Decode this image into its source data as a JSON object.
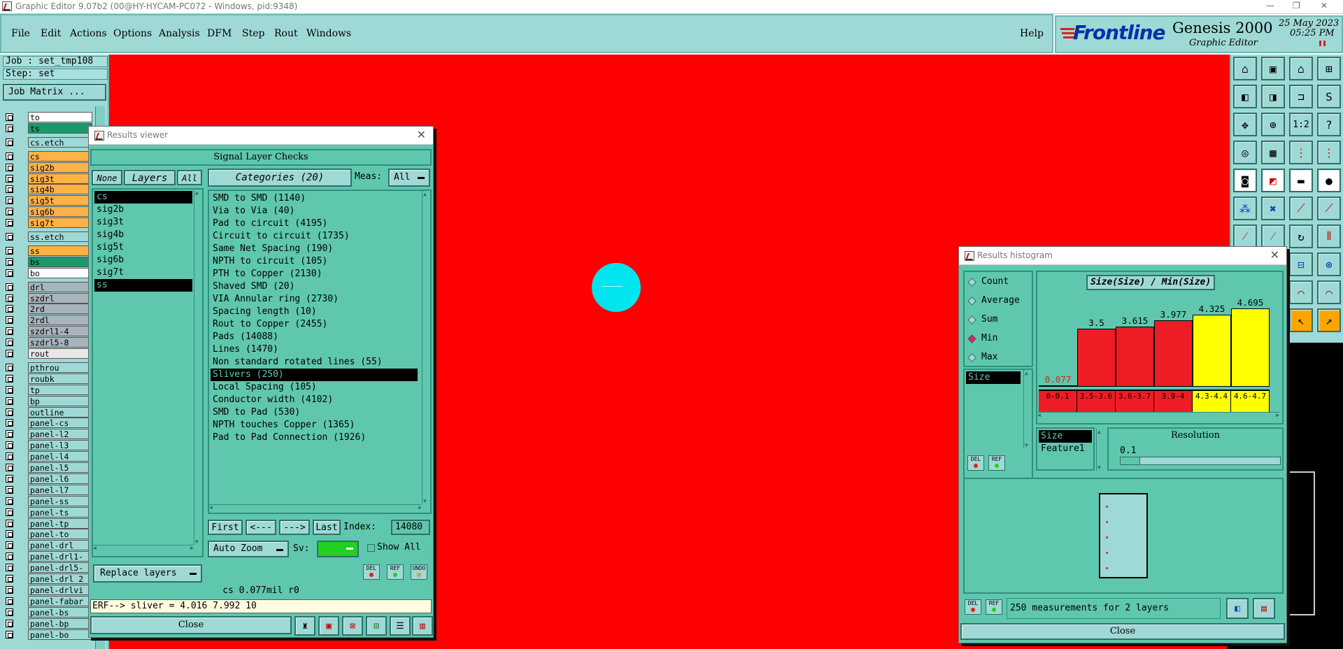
{
  "window": {
    "title": "Graphic Editor 9.07b2 (00@HY-HYCAM-PC072 - Windows, pid:9348)",
    "controls": [
      "—",
      "❐",
      "✕"
    ]
  },
  "menu": [
    "File",
    "Edit",
    "Actions",
    "Options",
    "Analysis",
    "DFM",
    "Step",
    "Rout",
    "Windows"
  ],
  "help_label": "Help",
  "brand": {
    "logo": "Frontline",
    "product": "Genesis 2000",
    "subtitle": "Graphic Editor",
    "date": "25 May 2023",
    "time": "05:25 PM"
  },
  "left_panel": {
    "job": "Job : set_tmp108",
    "step": "Step: set",
    "job_matrix": "Job Matrix ..."
  },
  "layers": [
    {
      "name": "to",
      "bg": "#ffffff"
    },
    {
      "name": "ts",
      "bg": "#1a9a6a"
    },
    {
      "name": "cs.etch",
      "bg": "#9fd9d6"
    },
    {
      "name": "cs",
      "bg": "#ffb347"
    },
    {
      "name": "sig2b",
      "bg": "#ffb347"
    },
    {
      "name": "sig3t",
      "bg": "#ffb347"
    },
    {
      "name": "sig4b",
      "bg": "#ffb347"
    },
    {
      "name": "sig5t",
      "bg": "#ffb347"
    },
    {
      "name": "sig6b",
      "bg": "#ffb347"
    },
    {
      "name": "sig7t",
      "bg": "#ffb347"
    },
    {
      "name": "ss.etch",
      "bg": "#9fd9d6"
    },
    {
      "name": "ss",
      "bg": "#ffb347"
    },
    {
      "name": "bs",
      "bg": "#1a9a6a"
    },
    {
      "name": "bo",
      "bg": "#ffffff"
    },
    {
      "name": "drl",
      "bg": "#a9b3bd"
    },
    {
      "name": "szdrl",
      "bg": "#a9b3bd"
    },
    {
      "name": "2rd",
      "bg": "#a9b3bd"
    },
    {
      "name": "2rdl",
      "bg": "#a9b3bd"
    },
    {
      "name": "szdrl1-4",
      "bg": "#a9b3bd"
    },
    {
      "name": "szdrl5-8",
      "bg": "#a9b3bd"
    },
    {
      "name": "rout",
      "bg": "#e8e8e8"
    },
    {
      "name": "pthrou",
      "bg": "#9fd9d6"
    },
    {
      "name": "roubk",
      "bg": "#9fd9d6"
    },
    {
      "name": "tp",
      "bg": "#9fd9d6"
    },
    {
      "name": "bp",
      "bg": "#9fd9d6"
    },
    {
      "name": "outline",
      "bg": "#9fd9d6"
    },
    {
      "name": "panel-cs",
      "bg": "#9fd9d6"
    },
    {
      "name": "panel-l2",
      "bg": "#9fd9d6"
    },
    {
      "name": "panel-l3",
      "bg": "#9fd9d6"
    },
    {
      "name": "panel-l4",
      "bg": "#9fd9d6"
    },
    {
      "name": "panel-l5",
      "bg": "#9fd9d6"
    },
    {
      "name": "panel-l6",
      "bg": "#9fd9d6"
    },
    {
      "name": "panel-l7",
      "bg": "#9fd9d6"
    },
    {
      "name": "panel-ss",
      "bg": "#9fd9d6"
    },
    {
      "name": "panel-ts",
      "bg": "#9fd9d6"
    },
    {
      "name": "panel-tp",
      "bg": "#9fd9d6"
    },
    {
      "name": "panel-to",
      "bg": "#9fd9d6"
    },
    {
      "name": "panel-drl",
      "bg": "#9fd9d6"
    },
    {
      "name": "panel-drl1-",
      "bg": "#9fd9d6"
    },
    {
      "name": "panel-drl5-",
      "bg": "#9fd9d6"
    },
    {
      "name": "panel-drl_2",
      "bg": "#9fd9d6"
    },
    {
      "name": "panel-drlvi",
      "bg": "#9fd9d6"
    },
    {
      "name": "panel-fabar",
      "bg": "#9fd9d6"
    },
    {
      "name": "panel-bs",
      "bg": "#9fd9d6"
    },
    {
      "name": "panel-bp",
      "bg": "#9fd9d6"
    },
    {
      "name": "panel-bo",
      "bg": "#9fd9d6"
    }
  ],
  "results_viewer": {
    "title": "Results viewer",
    "header": "Signal Layer Checks",
    "none_label": "None",
    "layers_label": "Layers",
    "all_label": "All",
    "categories_label": "Categories (20)",
    "meas_label": "Meas:",
    "meas_value": "All",
    "layer_list": [
      "cs",
      "sig2b",
      "sig3t",
      "sig4b",
      "sig5t",
      "sig6b",
      "sig7t",
      "ss"
    ],
    "selected_layers": [
      "cs",
      "ss"
    ],
    "categories": [
      "SMD to SMD (1140)",
      "Via to Via (40)",
      "Pad to circuit (4195)",
      "Circuit to circuit (1735)",
      "Same Net Spacing (190)",
      "NPTH to circuit (105)",
      "PTH to Copper (2130)",
      "Shaved SMD (20)",
      "VIA Annular ring (2730)",
      "Spacing length (10)",
      "Rout to Copper (2455)",
      "Pads (14088)",
      "Lines (1470)",
      "Non standard rotated lines (55)",
      "Slivers (250)",
      "Local Spacing (105)",
      "Conductor width (4102)",
      "SMD to Pad (530)",
      "NPTH touches Copper (1365)",
      "Pad to Pad Connection (1926)"
    ],
    "selected_category": "Slivers (250)",
    "first": "First",
    "prev": "<---",
    "next": "--->",
    "last": "Last",
    "index_label": "Index:",
    "index_value": "14080",
    "auto_zoom": "Auto Zoom",
    "sv_label": "Sv:",
    "show_all": "Show All",
    "replace_layers": "Replace layers",
    "del": "DEL",
    "ref": "REF",
    "undo": "UNDO",
    "status": "cs 0.077mil  r0",
    "erf": "ERF--> sliver = 4.016 7.992 10",
    "close": "Close"
  },
  "histogram": {
    "title": "Results histogram",
    "modes": [
      "Count",
      "Average",
      "Sum",
      "Min",
      "Max"
    ],
    "selected_mode": "Min",
    "size_list": [
      "Size"
    ],
    "chart_title": "Size(Size) / Min(Size)",
    "attr_list": [
      "Size",
      "Feature1"
    ],
    "resolution_label": "Resolution",
    "resolution_value": "0.1",
    "summary": "250 measurements for 2 layers",
    "del": "DEL",
    "ref": "REF",
    "close": "Close"
  },
  "chart_data": {
    "type": "bar",
    "title": "Size(Size) / Min(Size)",
    "categories": [
      "0-0.1",
      "3.5-3.6",
      "3.6-3.7",
      "3.9-4",
      "4.3-4.4",
      "4.6-4.7"
    ],
    "values": [
      0.077,
      3.5,
      3.615,
      3.977,
      4.325,
      4.695
    ],
    "value_labels": [
      "0.077",
      "3.5",
      "3.615",
      "3.977",
      "4.325",
      "4.695"
    ],
    "colors": [
      "#ee1c25",
      "#ee1c25",
      "#ee1c25",
      "#ee1c25",
      "#ffff00",
      "#ffff00"
    ],
    "ylim": [
      0,
      4.695
    ]
  },
  "colors": {
    "canvas": "#ff0000",
    "panel": "#5fc7ad",
    "chrome": "#9fd9d6",
    "highlight_circle": "#00e5ee"
  }
}
